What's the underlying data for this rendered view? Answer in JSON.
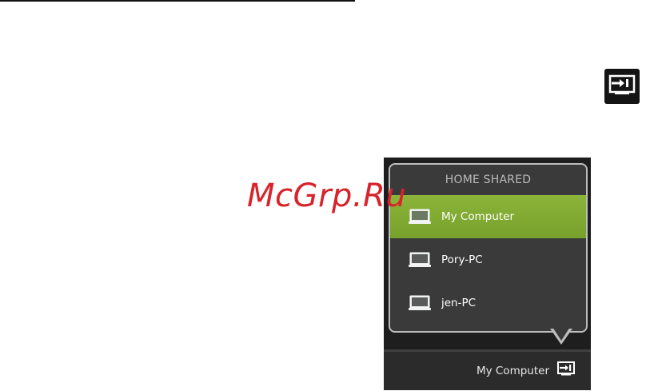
{
  "watermark": "McGrp.Ru",
  "popup": {
    "header": "HOME SHARED",
    "devices": [
      {
        "label": "My Computer",
        "selected": true
      },
      {
        "label": "Pory-PC",
        "selected": false
      },
      {
        "label": "jen-PC",
        "selected": false
      }
    ]
  },
  "bottom_bar": {
    "current_device": "My Computer"
  },
  "icons": {
    "cast": "play-to-device-icon",
    "device": "laptop-icon"
  },
  "colors": {
    "selected_row": "#80ab33",
    "popup_bg": "#3a3a3a",
    "bar_bg": "#2b2b2b",
    "watermark": "#d8232a"
  }
}
